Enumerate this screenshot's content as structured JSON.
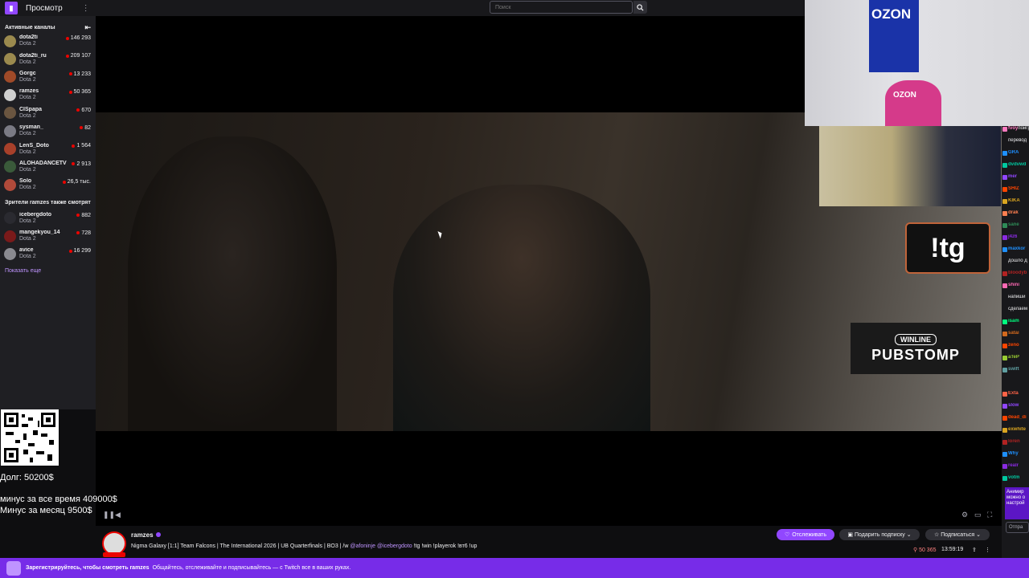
{
  "topbar": {
    "browse_label": "Просмотр",
    "search_placeholder": "Поиск"
  },
  "sidebar": {
    "active_header": "Активные каналы",
    "channels": [
      {
        "name": "dota2ti",
        "game": "Dota 2",
        "viewers": "146 293",
        "color": "#9b8a4e"
      },
      {
        "name": "dota2ti_ru",
        "game": "Dota 2",
        "viewers": "209 107",
        "color": "#9b8a4e"
      },
      {
        "name": "Gorgc",
        "game": "Dota 2",
        "viewers": "13 233",
        "color": "#a04a28"
      },
      {
        "name": "ramzes",
        "game": "Dota 2",
        "viewers": "50 365",
        "color": "#cfcfcf"
      },
      {
        "name": "CISpapa",
        "game": "Dota 2",
        "viewers": "670",
        "color": "#6a5540"
      },
      {
        "name": "sysman_",
        "game": "Dota 2",
        "viewers": "82",
        "color": "#7a7a84"
      },
      {
        "name": "LenS_Doto",
        "game": "Dota 2",
        "viewers": "1 564",
        "color": "#a8402a"
      },
      {
        "name": "ALOHADANCETV",
        "game": "Dota 2",
        "viewers": "2 913",
        "color": "#3a5a3a"
      },
      {
        "name": "Solo",
        "game": "Dota 2",
        "viewers": "26,5 тыс.",
        "color": "#b04a3a"
      }
    ],
    "also_watch_header": "Зрители ramzes также смотрят",
    "also_watch": [
      {
        "name": "icebergdoto",
        "game": "Dota 2",
        "viewers": "882",
        "color": "#2a2a30"
      },
      {
        "name": "mangekyou_14",
        "game": "Dota 2",
        "viewers": "728",
        "color": "#7a1a1a"
      },
      {
        "name": "avice",
        "game": "Dota 2",
        "viewers": "16 299",
        "color": "#8a8a90"
      }
    ],
    "show_more": "Показать еще"
  },
  "overlay": {
    "debt": "Долг: 50200$",
    "minus_all": "минус за все время 409000$",
    "minus_month": "Минус за месяц 9500$",
    "tg_badge": "!tg",
    "cam_logo": "OZON",
    "pubstomp_top": "WINLINE",
    "pubstomp_main": "PUBSTOMP"
  },
  "stream": {
    "channel": "ramzes",
    "title_pre": "Nigma Galaxy [1:1] Team Falcons | The International 2026 | UB Quarterfinals | BO3 | /w ",
    "mention1": "@afoninje",
    "mention2": "@icebergdoto",
    "title_post": " !tg !win !playerok !вт6 !up",
    "follow_label": "Отслеживать",
    "gift_label": "Подарить подписку",
    "subscribe_label": "Подписаться",
    "viewers": "50 365",
    "uptime": "13:59:19"
  },
  "chat": {
    "lines": [
      {
        "user": "fvoy",
        "text": "поигра",
        "color": "#ff7ac0"
      },
      {
        "user": "",
        "text": "перевод",
        "color": "#efeff1"
      },
      {
        "user": "GRA",
        "text": "",
        "color": "#1e90ff"
      },
      {
        "user": "dvdvwd",
        "text": "",
        "color": "#00c8a0"
      },
      {
        "user": "mer",
        "text": "",
        "color": "#9147ff"
      },
      {
        "user": "SHIZ",
        "text": "",
        "color": "#ff4500"
      },
      {
        "user": "KIKA",
        "text": "",
        "color": "#daa520"
      },
      {
        "user": "drak",
        "text": "",
        "color": "#ff7f50"
      },
      {
        "user": "sane",
        "text": "",
        "color": "#2e8b57"
      },
      {
        "user": "j4z6",
        "text": "",
        "color": "#8a2be2"
      },
      {
        "user": "maxkor",
        "text": "",
        "color": "#1e90ff"
      },
      {
        "user": "",
        "text": "дошло д",
        "color": "#efeff1"
      },
      {
        "user": "bloodyb",
        "text": "",
        "color": "#b22222"
      },
      {
        "user": "shini",
        "text": "",
        "color": "#ff69b4"
      },
      {
        "user": "",
        "text": "напиши",
        "color": "#efeff1"
      },
      {
        "user": "",
        "text": "сделаем",
        "color": "#efeff1"
      },
      {
        "user": "isam",
        "text": "",
        "color": "#00ff7f"
      },
      {
        "user": "satai",
        "text": "",
        "color": "#d2691e"
      },
      {
        "user": "zeno",
        "text": "",
        "color": "#ff4500"
      },
      {
        "user": "aTeP",
        "text": "",
        "color": "#9acd32"
      },
      {
        "user": "swift",
        "text": "",
        "color": "#5f9ea0"
      },
      {
        "user": "",
        "text": "",
        "color": "#efeff1"
      },
      {
        "user": "Exta",
        "text": "",
        "color": "#ff6347"
      },
      {
        "user": "slow",
        "text": "",
        "color": "#9147ff"
      },
      {
        "user": "dead_di",
        "text": "",
        "color": "#ff4500"
      },
      {
        "user": "exwhite",
        "text": "",
        "color": "#daa520"
      },
      {
        "user": "loren",
        "text": "",
        "color": "#b22222"
      },
      {
        "user": "Why",
        "text": "",
        "color": "#1e90ff"
      },
      {
        "user": "realr",
        "text": "",
        "color": "#8a2be2"
      },
      {
        "user": "votm",
        "text": "",
        "color": "#00c8a0"
      }
    ],
    "promo": "Анимир можно о настрой",
    "send_label": "Отпра"
  },
  "banner": {
    "strong": "Зарегистрируйтесь, чтобы смотреть ramzes",
    "text": "Общайтесь, отслеживайте и подписывайтесь — с Twitch все в ваших руках."
  },
  "colors": {
    "accent": "#9147ff",
    "live": "#eb0400",
    "banner": "#772ce8"
  }
}
